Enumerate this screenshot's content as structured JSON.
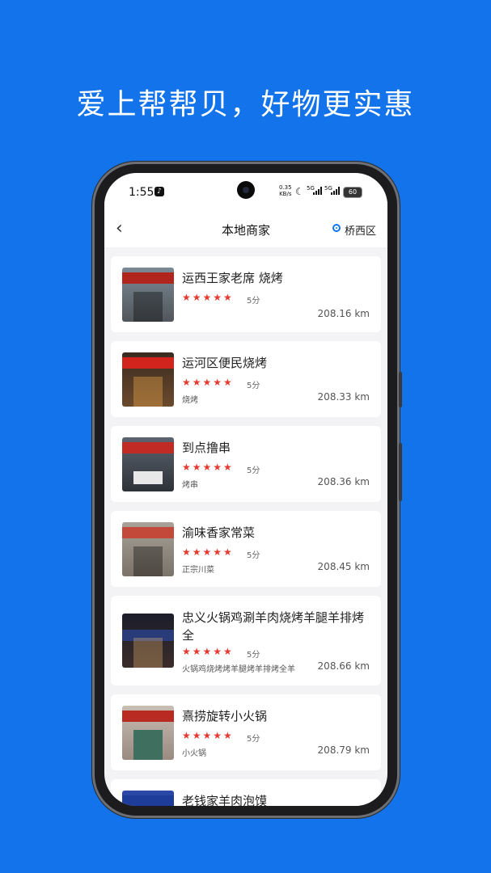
{
  "headline": "爱上帮帮贝，好物更实惠",
  "status_bar": {
    "time": "1:55",
    "net_speed": "0.35",
    "net_unit": "KB/s",
    "sim1": "5G",
    "sim2": "5G",
    "battery": "60"
  },
  "nav": {
    "back_icon": "chevron-left-icon",
    "title": "本地商家",
    "location": "桥西区"
  },
  "colors": {
    "accent": "#1273ea",
    "star": "#e53a2f"
  },
  "merchants": [
    {
      "name": "运西王家老席 烧烤",
      "stars": "★★★★★",
      "score": "5分",
      "tag": "",
      "distance": "208.16 km"
    },
    {
      "name": "运河区便民烧烤",
      "stars": "★★★★★",
      "score": "5分",
      "tag": "烧烤",
      "distance": "208.33 km"
    },
    {
      "name": "到点撸串",
      "stars": "★★★★★",
      "score": "5分",
      "tag": "烤串",
      "distance": "208.36 km"
    },
    {
      "name": "渝味香家常菜",
      "stars": "★★★★★",
      "score": "5分",
      "tag": "正宗川菜",
      "distance": "208.45 km"
    },
    {
      "name": "忠义火锅鸡涮羊肉烧烤羊腿羊排烤全",
      "stars": "★★★★★",
      "score": "5分",
      "tag": "火锅鸡烧烤烤羊腿烤羊排烤全羊",
      "distance": "208.66 km"
    },
    {
      "name": "熹捞旋转小火锅",
      "stars": "★★★★★",
      "score": "5分",
      "tag": "小火锅",
      "distance": "208.79 km"
    },
    {
      "name": "老钱家羊肉泡馍",
      "stars": "",
      "score": "",
      "tag": "",
      "distance": ""
    }
  ]
}
